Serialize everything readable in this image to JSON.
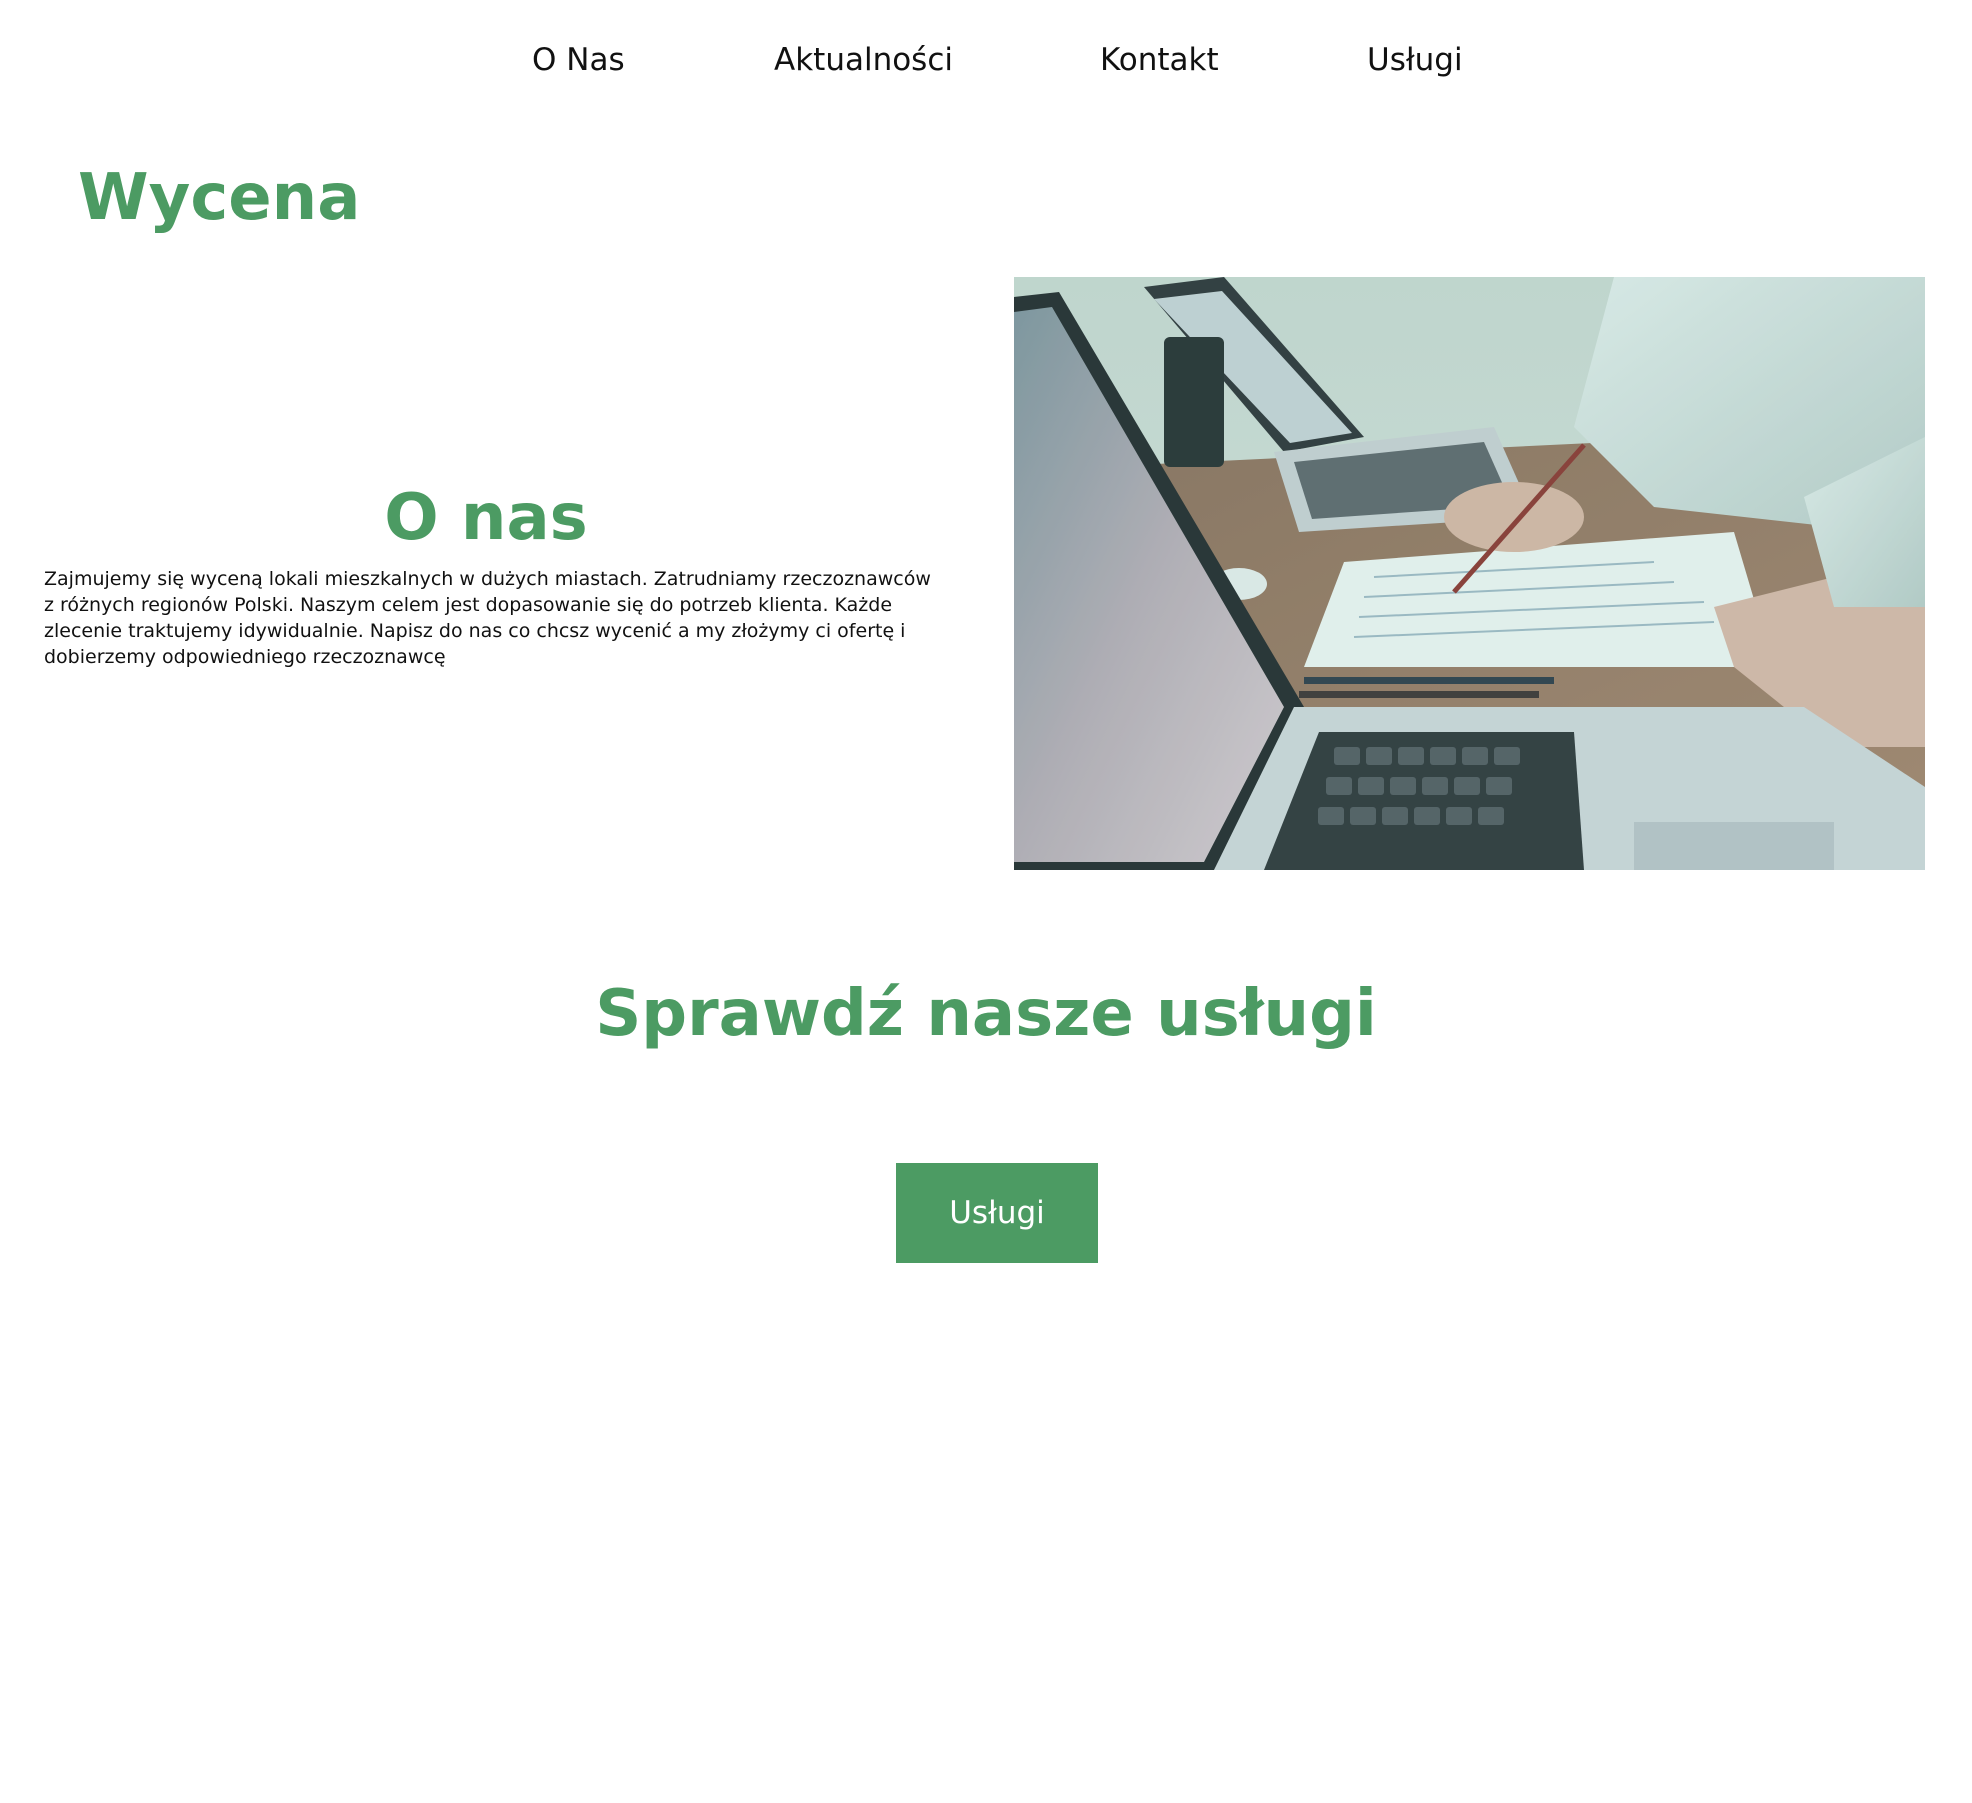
{
  "nav": {
    "items": [
      {
        "label": "O Nas"
      },
      {
        "label": "Aktualności"
      },
      {
        "label": "Kontakt"
      },
      {
        "label": "Usługi"
      }
    ]
  },
  "brand": {
    "title": "Wycena"
  },
  "about": {
    "title": "O nas",
    "text": "Zajmujemy się wyceną lokali mieszkalnych w dużych miastach. Zatrudniamy rzeczoznawców z różnych regionów Polski. Naszym celem jest dopasowanie się do potrzeb klienta. Każde zlecenie traktujemy idywidualnie. Napisz do nas co chcsz wycenić a my złożymy ci ofertę i dobierzemy odpowiedniego rzeczoznawcę"
  },
  "services": {
    "title": "Sprawdź nasze usługi",
    "button_label": "Usługi"
  },
  "colors": {
    "accent": "#4c9b63",
    "text": "#111111",
    "background": "#ffffff"
  }
}
